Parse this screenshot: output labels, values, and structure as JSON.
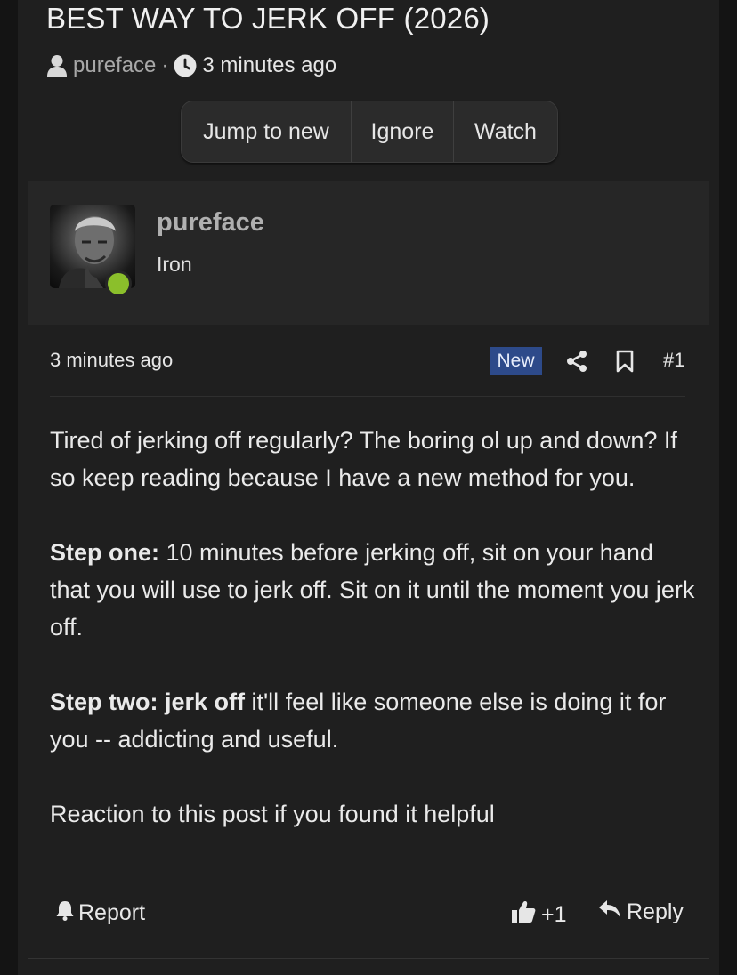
{
  "thread": {
    "title": "BEST WAY TO JERK OFF (2026)",
    "author": "pureface",
    "separator": "·",
    "time": "3 minutes ago"
  },
  "buttons": {
    "jump": "Jump to new",
    "ignore": "Ignore",
    "watch": "Watch"
  },
  "user": {
    "name": "pureface",
    "title": "Iron",
    "status": "online",
    "status_color": "#8bbf2b"
  },
  "post": {
    "time": "3 minutes ago",
    "badge": "New",
    "badge_color": "#2d4a8a",
    "number": "#1",
    "para1": "Tired of jerking off regularly? The boring ol up and down? If so keep reading because I have a new method for you.",
    "step1_label": "Step one:",
    "step1_text": " 10 minutes before jerking off, sit on your hand that you will use to jerk off. Sit on it until the moment you jerk off.",
    "step2_label": "Step two: jerk off",
    "step2_text": " it'll feel like someone else is doing it for you -- addicting and useful.",
    "para4": "Reaction to this post if you found it helpful"
  },
  "actions": {
    "report": "Report",
    "like_count": "+1",
    "reply": "Reply"
  },
  "icons": {
    "author": "user-icon",
    "time": "clock-icon",
    "share": "share-icon",
    "bookmark": "bookmark-icon",
    "report": "bell-icon",
    "like": "thumbs-up-icon",
    "reply": "reply-arrow-icon"
  }
}
